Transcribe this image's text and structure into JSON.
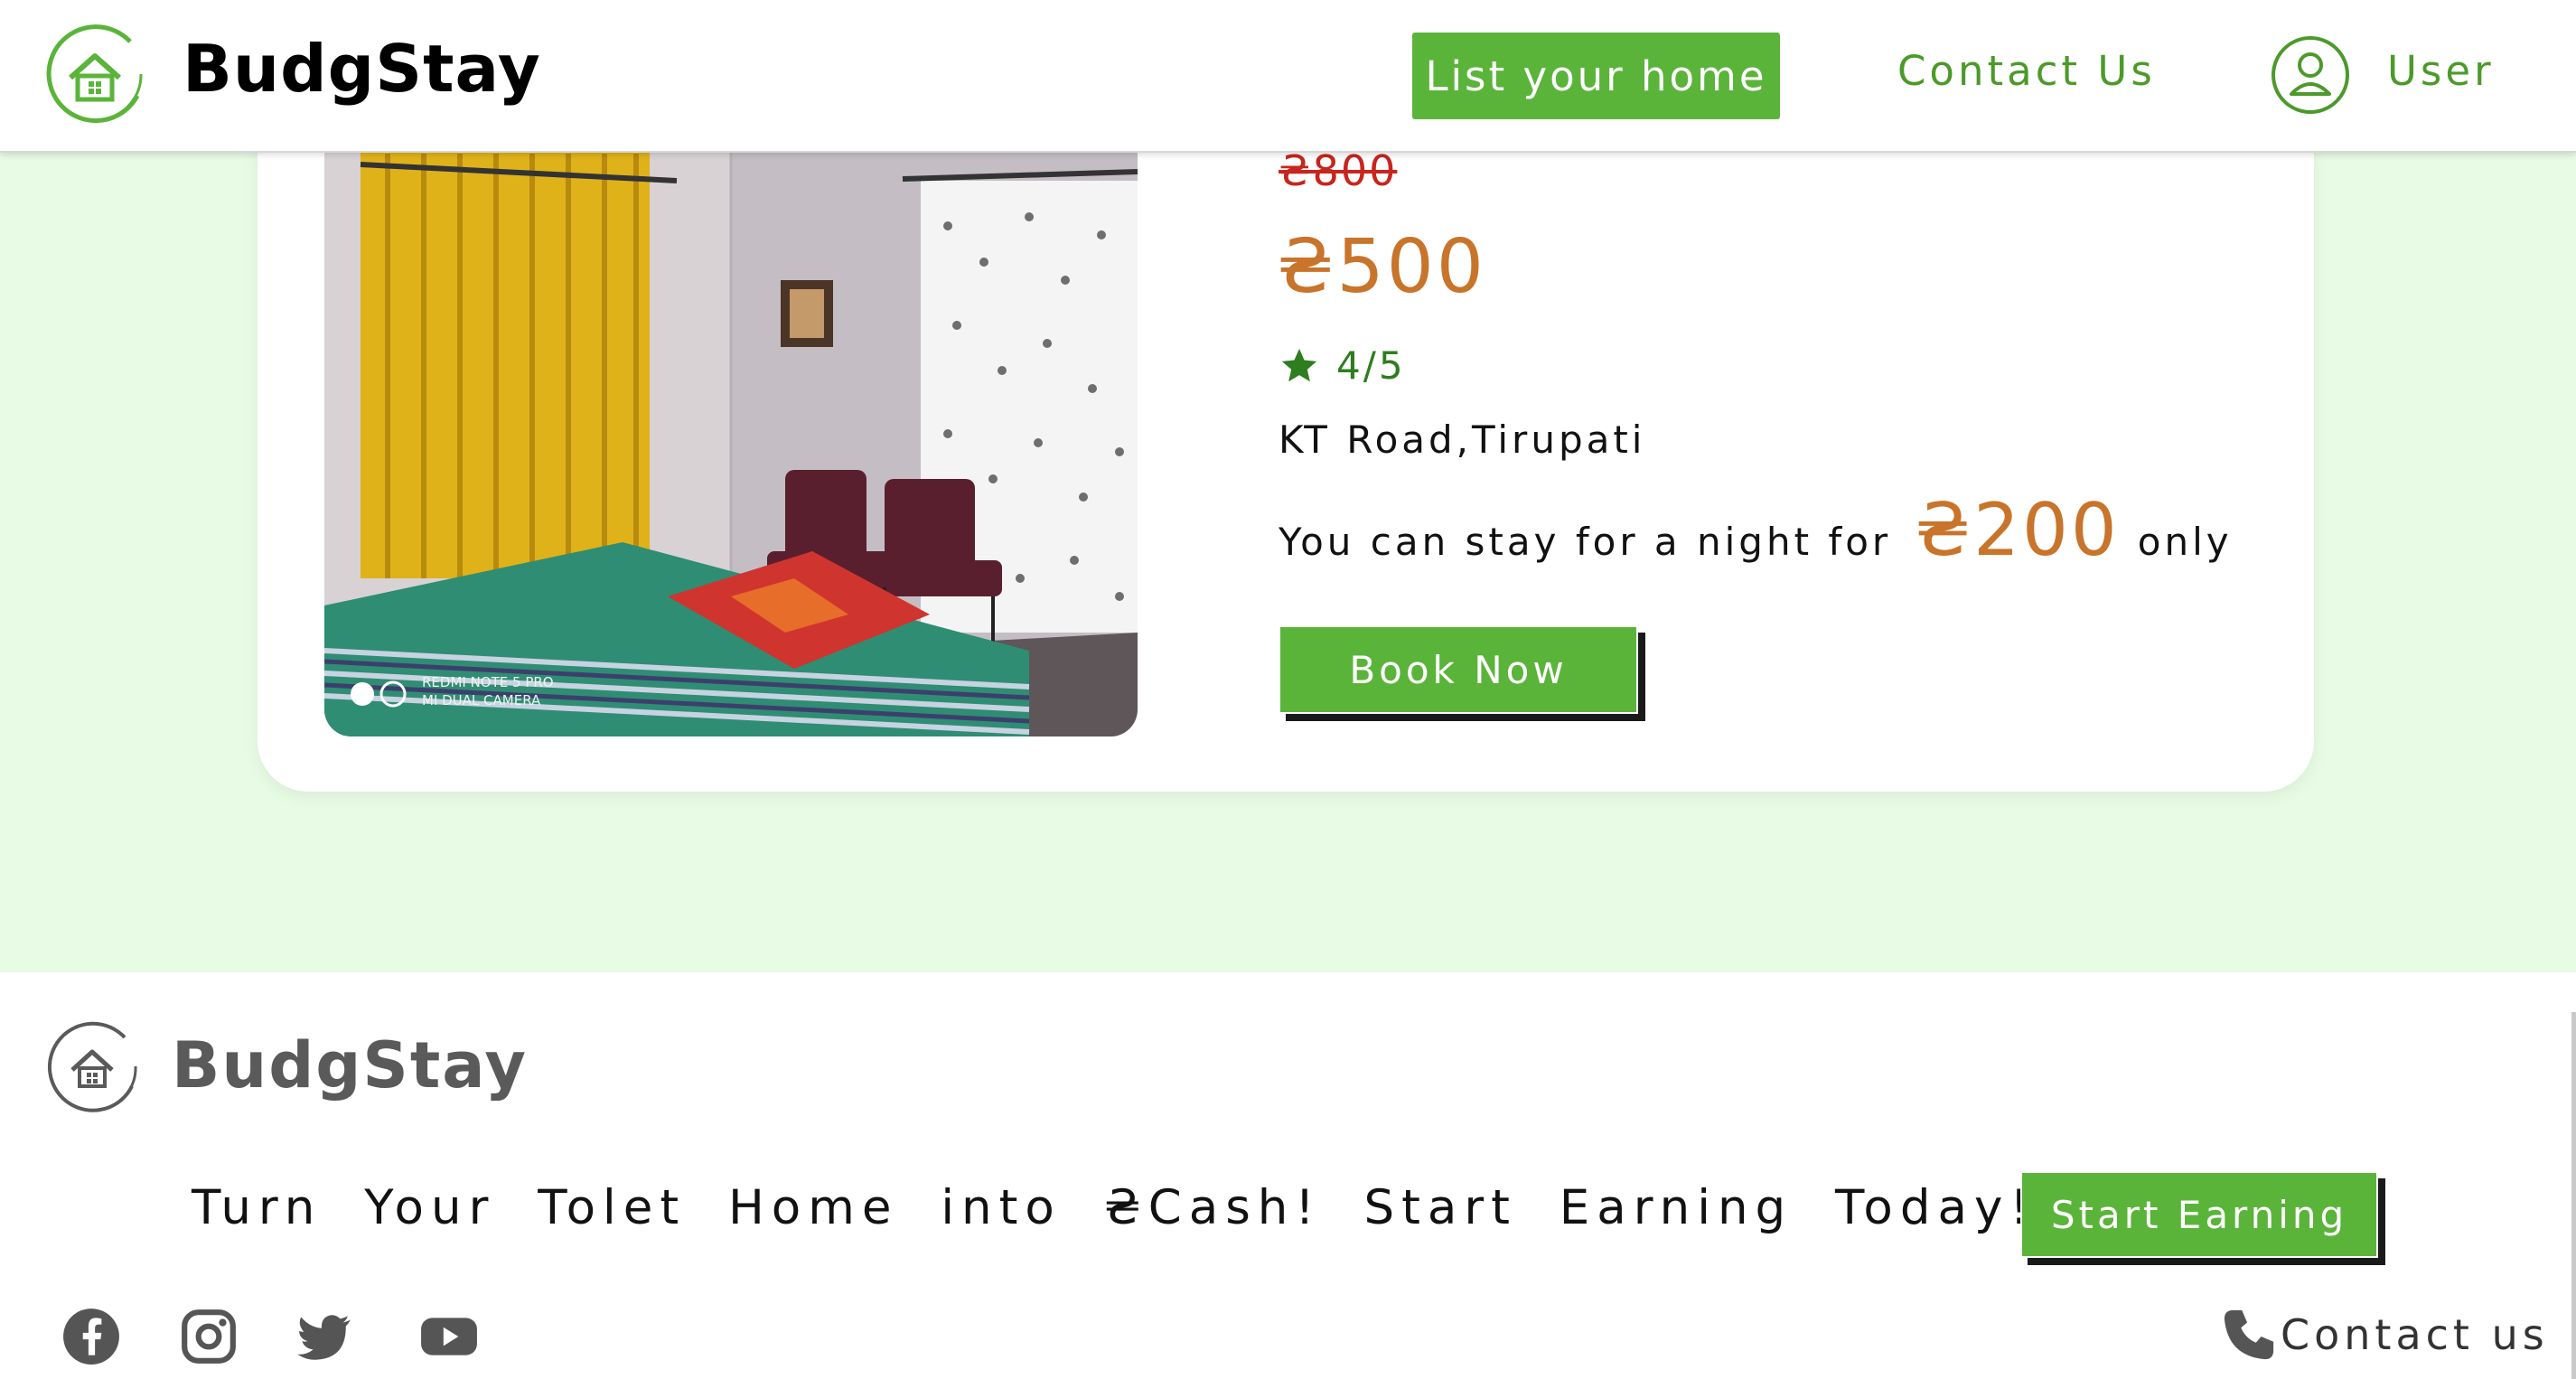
{
  "header": {
    "brand": "BudgStay",
    "nav": {
      "list_home": "List your home",
      "contact": "Contact Us",
      "user": "User"
    }
  },
  "listing": {
    "original_price": "₴800",
    "price": "₴500",
    "rating": "4/5",
    "location": "KT Road,Tirupati",
    "night_text_pre": "You can stay for a night for",
    "night_price": "₴200",
    "night_text_post": "only",
    "book_label": "Book Now",
    "photo": {
      "watermark_line1": "REDMI NOTE 5 PRO",
      "watermark_line2": "MI DUAL CAMERA",
      "carousel_dots": 2,
      "active_dot": 1
    }
  },
  "footer": {
    "brand": "BudgStay",
    "tagline": "Turn Your Tolet Home into ₴Cash! Start Earning Today!",
    "earn_label": "Start Earning",
    "contact_label": "Contact us",
    "social_icons": [
      "facebook-icon",
      "instagram-icon",
      "twitter-icon",
      "youtube-icon"
    ]
  },
  "colors": {
    "accent_green": "#5bb43a",
    "link_green": "#4c9a2a",
    "price_orange": "#c8742a",
    "strike_red": "#c7251d",
    "page_bg": "#e8fbe4"
  }
}
